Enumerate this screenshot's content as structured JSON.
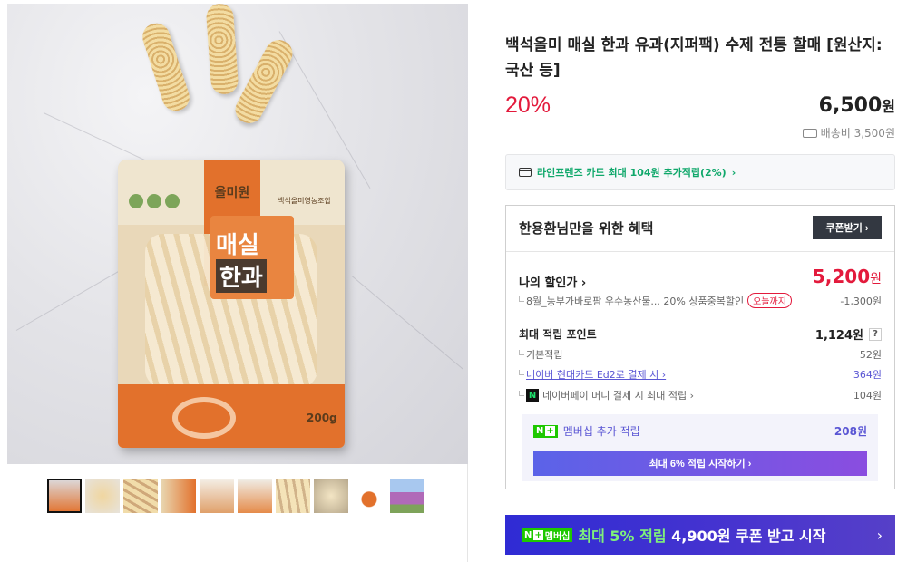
{
  "product": {
    "title": "백석올미 매실 한과 유과(지퍼팩) 수제 전통 할매 [원산지:국산 등]",
    "discount": "20%",
    "price": "6,500",
    "currency": "원",
    "shipping": "배송비 3,500원"
  },
  "packaging": {
    "brand": "올미원",
    "name_line1": "매실",
    "name_line2": "한과",
    "weight": "200g",
    "maker": "백석올미영농조합"
  },
  "card_promo": {
    "text": "라인프렌즈 카드 최대 104원 추가적립(2%)",
    "arrow": "›",
    "icon": "card-icon"
  },
  "benefit": {
    "heading": "한용환님만을 위한 혜택",
    "coupon_button": "쿠폰받기 ›",
    "my_price_label": "나의 할인가 ›",
    "my_price_value": "5,200",
    "my_price_unit": "원",
    "discount_detail": "8월_농부가바로팜 우수농산물...  20% 상품중복할인",
    "discount_tag": "오늘까지",
    "discount_amount": "-1,300원",
    "points_label": "최대 적립 포인트",
    "points_value": "1,124원",
    "points_help": "?",
    "points_rows": [
      {
        "label": "기본적립",
        "value": "52원"
      },
      {
        "label": "네이버 현대카드 Ed2로 결제 시 ›",
        "value": "364원"
      },
      {
        "label": "네이버페이 머니 결제 시 최대 적립 ›",
        "value": "104원"
      }
    ],
    "membership": {
      "badge_n": "N",
      "badge_plus": "+",
      "label": "멤버십 추가 적립",
      "value": "208원",
      "button": "최대 6% 적립 시작하기 ›"
    }
  },
  "bottom_banner": {
    "badge_n": "N",
    "badge_plus": "+",
    "badge_text": "멤버십",
    "text_accent": "최대 5% 적립",
    "text_rest": " 4,900원 쿠폰 받고 시작",
    "arrow": "›"
  },
  "thumbnails": {
    "count": 10,
    "active_index": 0
  },
  "colors": {
    "discount_red": "#e31a3c",
    "card_green": "#10a86b",
    "naver_purple": "#5a56d4",
    "naver_green": "#1ec800",
    "banner_blue": "#2f2bd4"
  }
}
